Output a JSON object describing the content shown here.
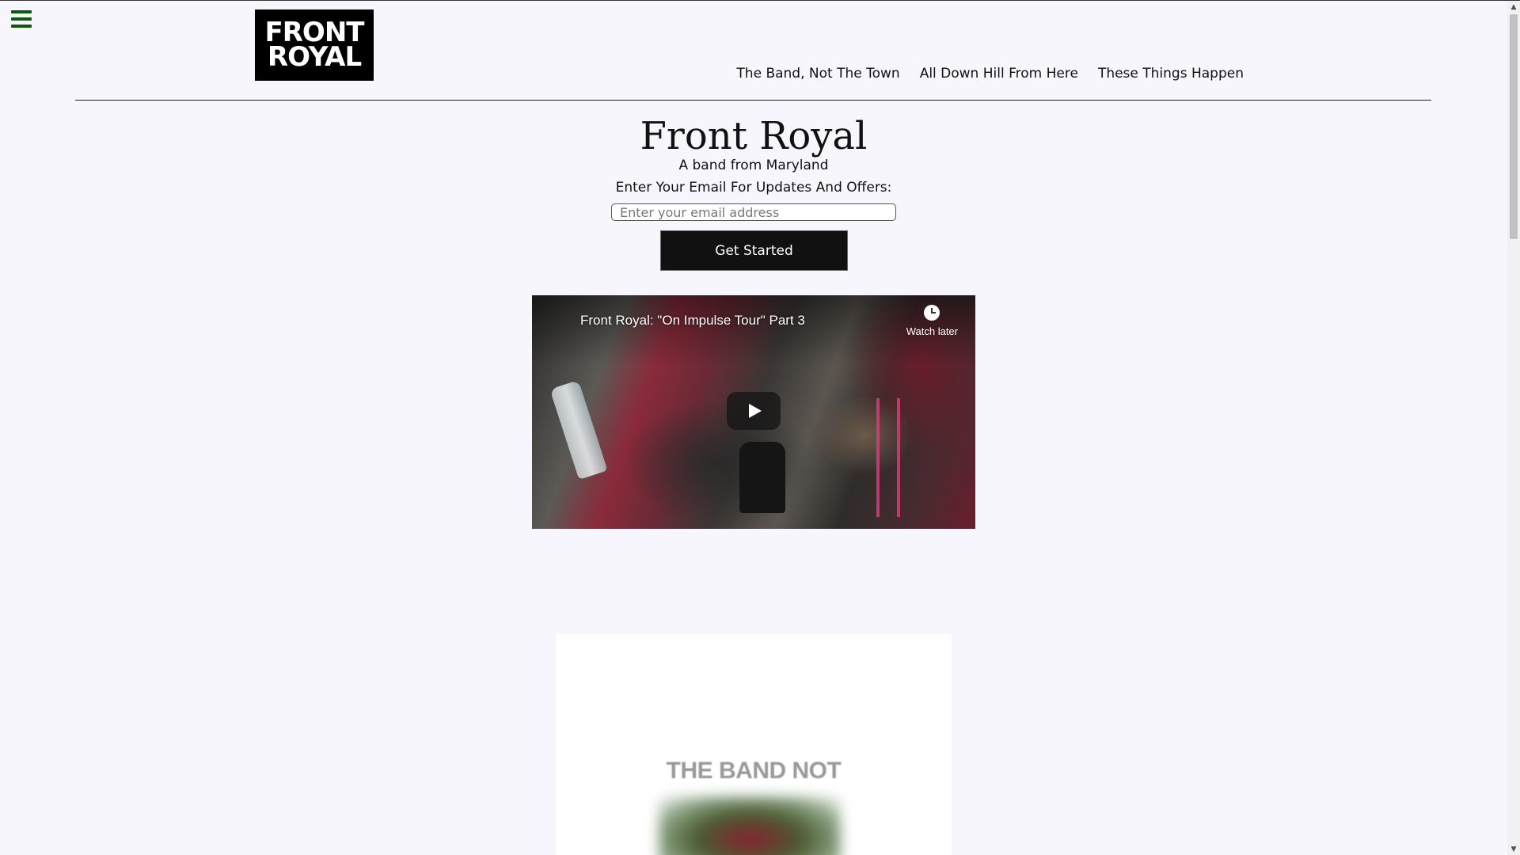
{
  "site": {
    "logo_line1": "FRONT",
    "logo_line2": "ROYAL"
  },
  "nav": [
    {
      "label": "The Band, Not The Town"
    },
    {
      "label": "All Down Hill From Here"
    },
    {
      "label": "These Things Happen"
    }
  ],
  "hero": {
    "title": "Front Royal",
    "subtitle": "A band from Maryland",
    "email_label": "Enter Your Email For Updates And Offers:",
    "email_placeholder": "Enter your email address",
    "email_value": "",
    "button_label": "Get Started"
  },
  "video": {
    "title": "Front Royal: \"On Impulse Tour\" Part 3",
    "watch_later": "Watch later"
  },
  "card": {
    "heading": "THE BAND NOT"
  },
  "colors": {
    "background": "#f6f6fc",
    "hamburger": "#0a5c0a",
    "button_bg": "#111111"
  }
}
